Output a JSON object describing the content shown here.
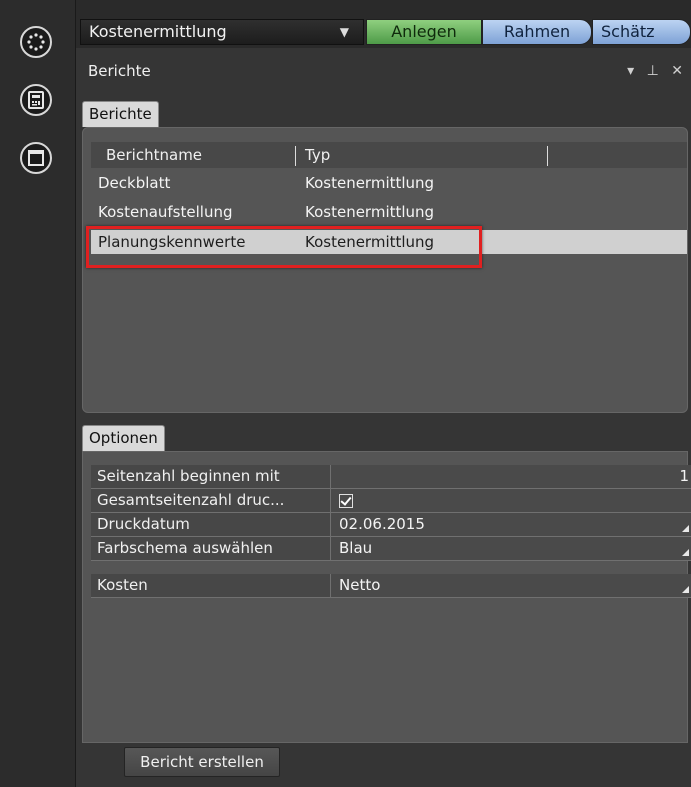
{
  "toolbar": {
    "combo_value": "Kostenermittlung",
    "tabs": [
      "Anlegen",
      "Rahmen",
      "Schätz"
    ]
  },
  "panel": {
    "title": "Berichte",
    "controls": "▾ ⊥ ✕"
  },
  "reports": {
    "tab_label": "Berichte",
    "columns": [
      "Berichtname",
      "Typ"
    ],
    "rows": [
      {
        "name": "Deckblatt",
        "type": "Kostenermittlung"
      },
      {
        "name": "Kostenaufstellung",
        "type": "Kostenermittlung"
      },
      {
        "name": "Planungskennwerte",
        "type": "Kostenermittlung"
      }
    ],
    "selected_index": 2
  },
  "options": {
    "tab_label": "Optionen",
    "rows": [
      {
        "label": "Seitenzahl beginnen mit",
        "value": "1"
      },
      {
        "label": "Gesamtseitenzahl druc...",
        "value": ""
      },
      {
        "label": "Druckdatum",
        "value": "02.06.2015"
      },
      {
        "label": "Farbschema auswählen",
        "value": "Blau"
      },
      {
        "label": "Kosten",
        "value": "Netto"
      }
    ],
    "gesamtseitenzahl_checked": true
  },
  "footer": {
    "create_button": "Bericht erstellen"
  },
  "colors": {
    "selection_highlight": "#e02020",
    "anlegen_tab": "#6db462",
    "rahmen_tab": "#9db9e4"
  }
}
